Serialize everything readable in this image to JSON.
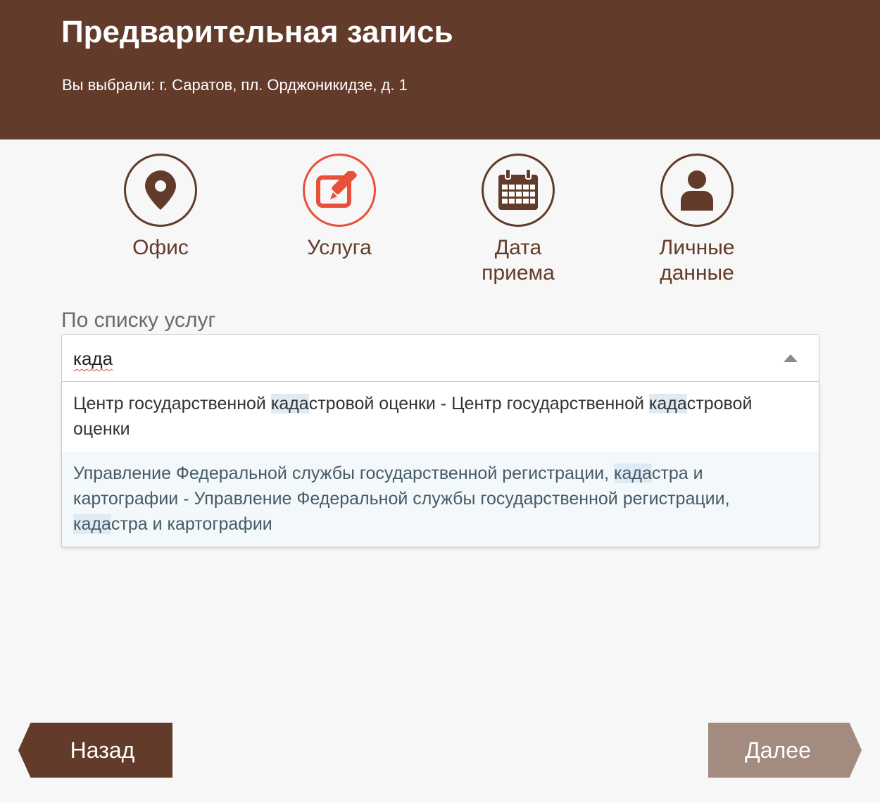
{
  "header": {
    "title": "Предварительная запись",
    "subtitle": "Вы выбрали: г. Саратов, пл. Орджоникидзе, д. 1"
  },
  "steps": [
    {
      "label_line1": "Офис",
      "label_line2": "",
      "icon": "map-pin-icon",
      "active": false
    },
    {
      "label_line1": "Услуга",
      "label_line2": "",
      "icon": "edit-icon",
      "active": true
    },
    {
      "label_line1": "Дата",
      "label_line2": "приема",
      "icon": "calendar-icon",
      "active": false
    },
    {
      "label_line1": "Личные",
      "label_line2": "данные",
      "icon": "user-icon",
      "active": false
    }
  ],
  "service_select": {
    "label": "По списку услуг",
    "value": "када",
    "options": [
      {
        "parts": [
          "Центр государственной ",
          "када",
          "стровой оценки - Центр государственной ",
          "када",
          "стровой оценки"
        ]
      },
      {
        "parts": [
          "Управление Федеральной службы государственной регистрации, ",
          "када",
          "стра и картографии - Управление Федеральной службы государственной регистрации, ",
          "када",
          "стра и картографии"
        ]
      }
    ]
  },
  "buttons": {
    "back": "Назад",
    "next": "Далее"
  },
  "colors": {
    "brand": "#633b2a",
    "active_step": "#e8503a",
    "next_disabled": "#a38b80",
    "match_highlight": "#deebf4"
  }
}
